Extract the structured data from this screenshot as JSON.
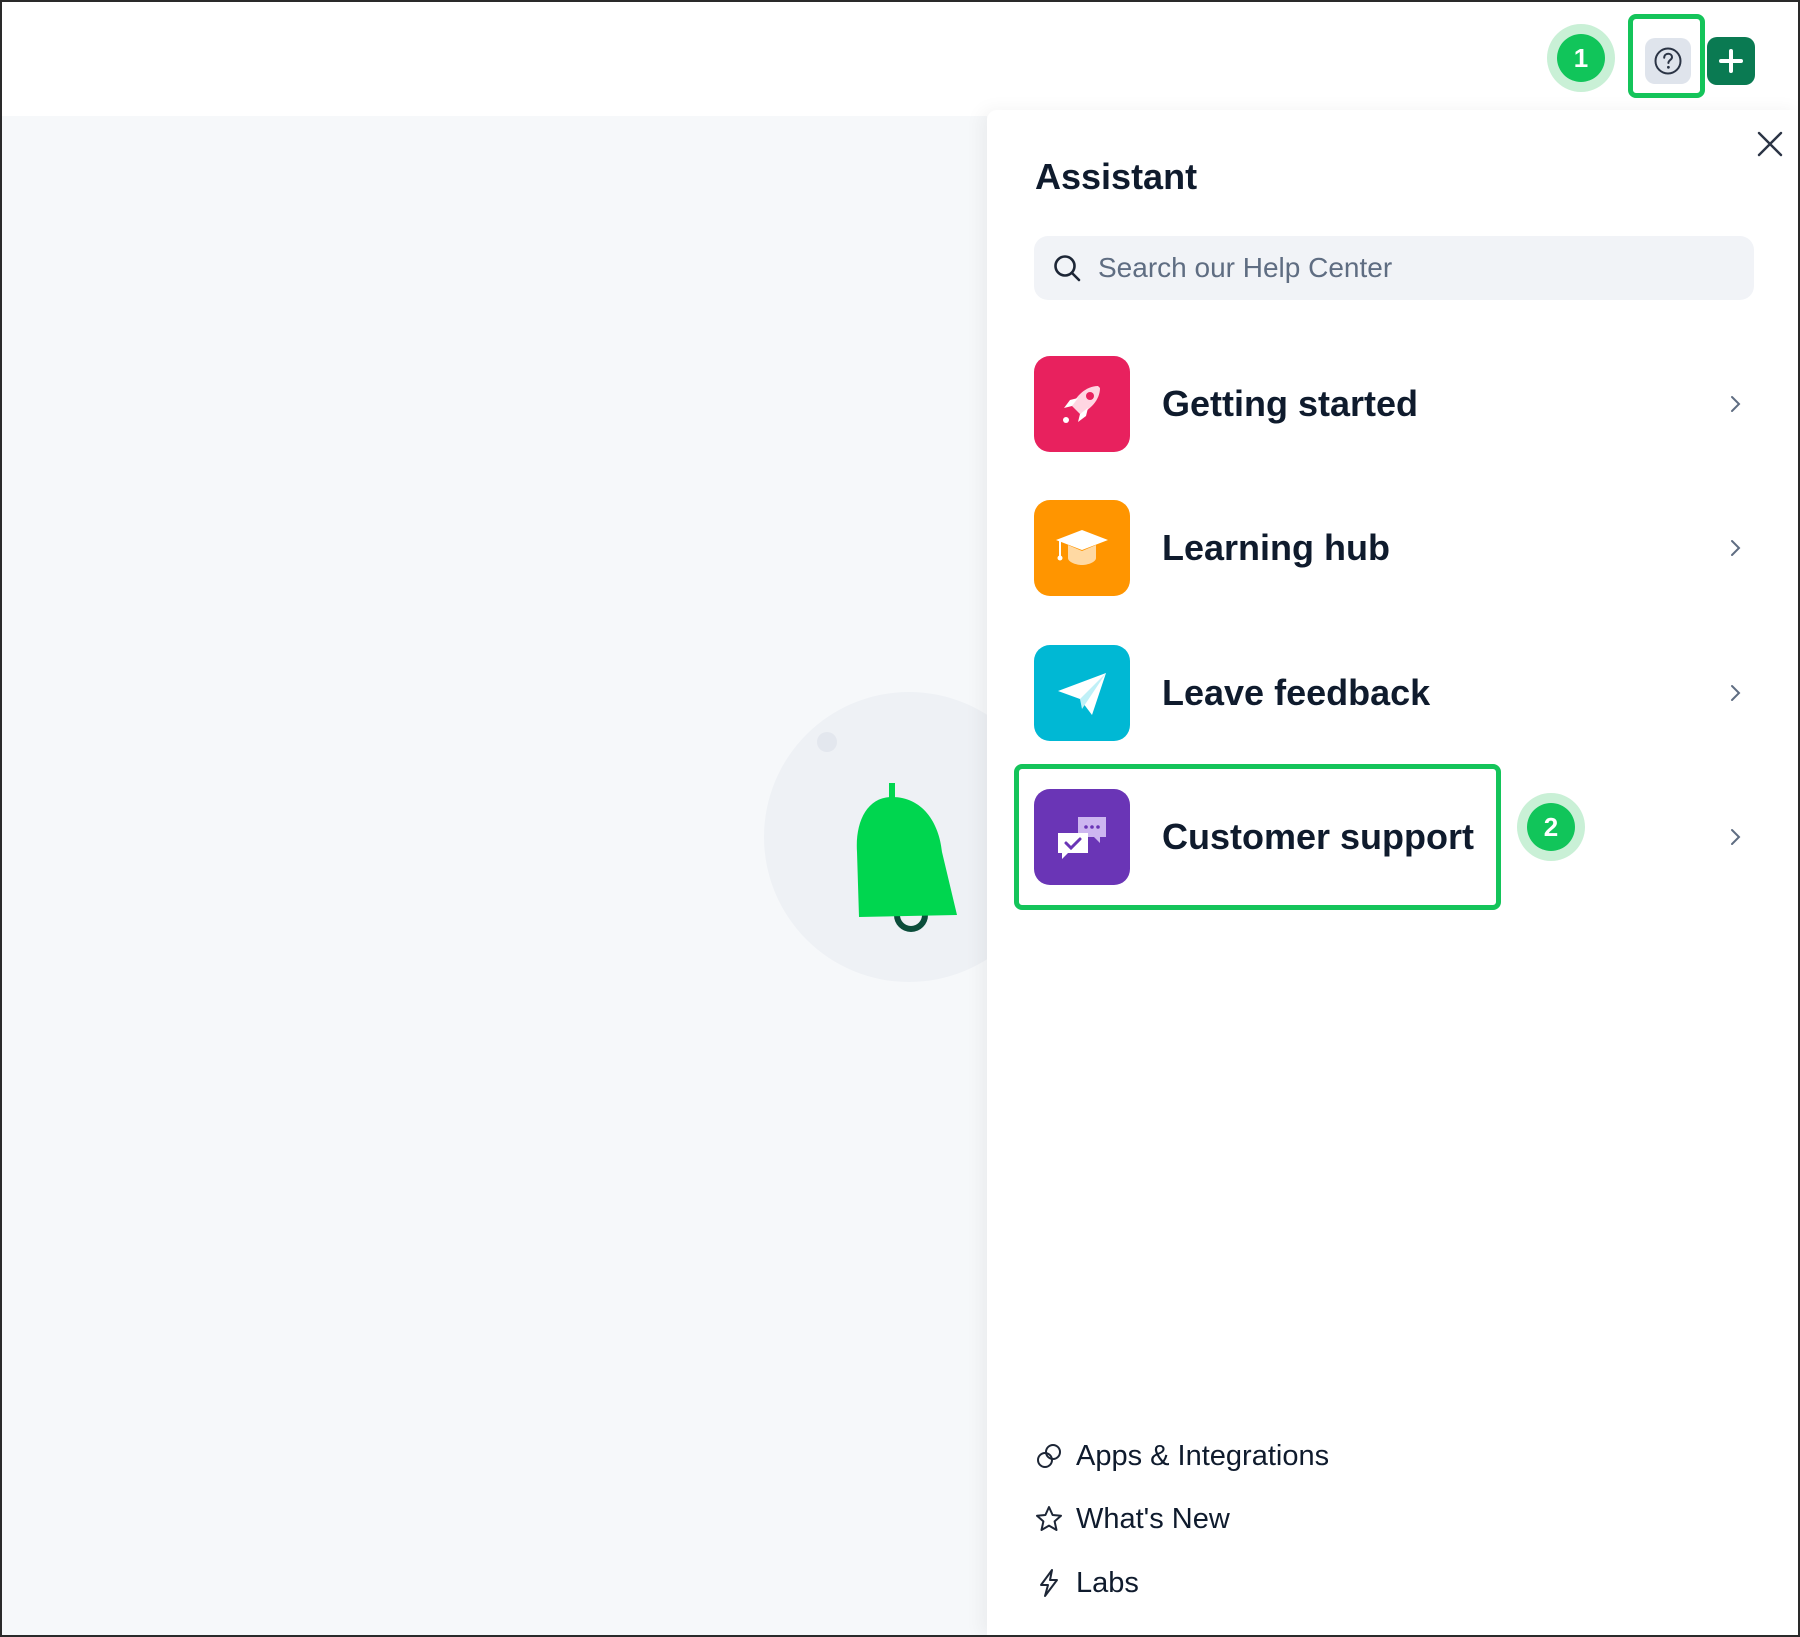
{
  "colors": {
    "accent_green": "#11c55a",
    "highlight_green": "#14c45a",
    "add_button": "#0a7a52",
    "getting_started": "#e8215e",
    "learning_hub": "#ff9500",
    "leave_feedback": "#00b8d4",
    "customer_support": "#6a35b6"
  },
  "topbar": {
    "step1": "1",
    "help_icon": "question-circle-icon",
    "add_icon": "plus-icon"
  },
  "assistant": {
    "title": "Assistant",
    "search_placeholder": "Search our Help Center",
    "items": [
      {
        "label": "Getting started",
        "icon": "rocket-icon"
      },
      {
        "label": "Learning hub",
        "icon": "graduation-cap-icon"
      },
      {
        "label": "Leave feedback",
        "icon": "paper-plane-icon"
      },
      {
        "label": "Customer support",
        "icon": "chat-bubbles-icon"
      }
    ],
    "step2": "2",
    "footer": [
      {
        "label": "Apps & Integrations",
        "icon": "link-icon"
      },
      {
        "label": "What's New",
        "icon": "star-icon"
      },
      {
        "label": "Labs",
        "icon": "lightning-icon"
      }
    ]
  }
}
